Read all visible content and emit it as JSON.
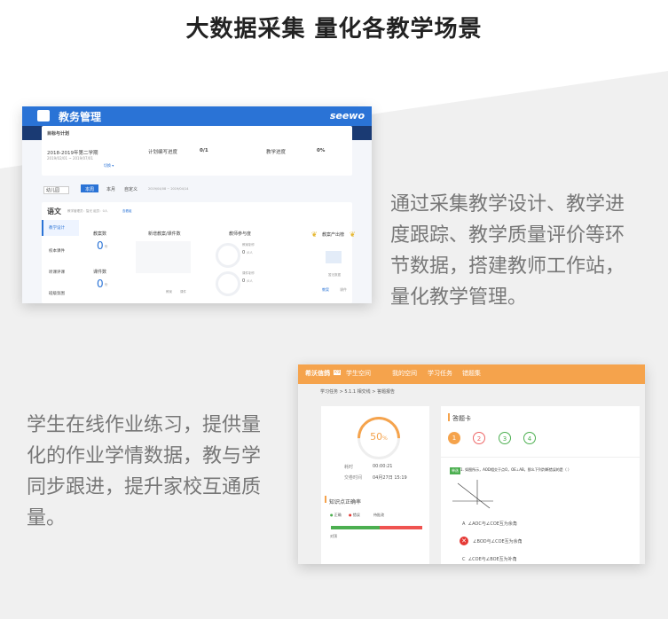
{
  "page": {
    "title": "大数据采集  量化各教学场景",
    "desc1": "通过采集教学设计、教学进度跟踪、教学质量评价等环节数据，搭建教师工作站，量化教学管理。",
    "desc2": "学生在线作业练习，提供量化的作业学情数据，教与学同步跟进，提升家校互通质量。"
  },
  "screen1": {
    "app_title": "教务管理",
    "brand": "seewo",
    "plan_label": "目标与计划",
    "semester": "2018-2019年第二学期",
    "semester_dates": "2019/02/01 ~ 2019/07/01",
    "switch_link": "切换 ▾",
    "plan_progress_label": "计划编写进度",
    "plan_progress_value": "0/1",
    "teach_progress_label": "教学进度",
    "teach_progress_value": "0%",
    "grade_select": "幼儿园",
    "tabs": [
      "本周",
      "本月",
      "自定义"
    ],
    "date_range": "2019/04/08 ~ 2019/04/14",
    "subject": "语文",
    "subject_meta": "教学管理员：智光  组员：0人",
    "subject_link": "查看组",
    "sidebar": [
      "教学设计",
      "校本课件",
      "听课评课",
      "班级氛围"
    ],
    "stats": {
      "lesson_count_label": "教案数",
      "lesson_count_value": "0",
      "courseware_label": "课件数",
      "courseware_value": "0",
      "unit": "份",
      "new_label": "新增教案/课件数",
      "teacher_label": "教师参与度",
      "teacher_lesson": "教案制作",
      "teacher_lesson_value": "0",
      "teacher_courseware": "课件制作",
      "teacher_courseware_value": "0",
      "person_unit": "/0人",
      "output_label": "教案产出榜",
      "no_data": "暂无数据",
      "output_tabs": [
        "教案",
        "课件"
      ],
      "legend": [
        "教案",
        "课件"
      ]
    }
  },
  "screen2": {
    "brand": "希沃信鸽",
    "brand_badge": "K9",
    "role": "学生空间",
    "nav": [
      "我的空间",
      "学习任务",
      "错题集"
    ],
    "breadcrumb": "学习任务  >  5.1.1 相交线  >  答题报告",
    "score_pct": "50",
    "score_unit": "%",
    "time_label": "耗时",
    "time_value": "00:00:21",
    "submit_label": "交卷时间",
    "submit_value": "04月27日 15:19",
    "knowledge_title": "知识点正确率",
    "legend": [
      "正确",
      "错误",
      "待批改"
    ],
    "knowledge_item": "对顶",
    "answer_card_title": "答题卡",
    "answer_numbers": [
      "1",
      "2",
      "3",
      "4"
    ],
    "question_type": "单选",
    "question_text": "1. 如图所示，AOD相交于点O，OE⊥AB，那么下列判断错误的是（ ）",
    "options": [
      {
        "key": "A",
        "text": "∠AOC与∠COE互为余角"
      },
      {
        "key": "B",
        "text": "∠BOD与∠COE互为余角"
      },
      {
        "key": "C",
        "text": "∠COE与∠BOE互为补角"
      }
    ]
  },
  "colors": {
    "accent_blue": "#2a73d6",
    "accent_orange": "#f5a34c",
    "correct_green": "#4caf50",
    "wrong_red": "#e53935"
  }
}
